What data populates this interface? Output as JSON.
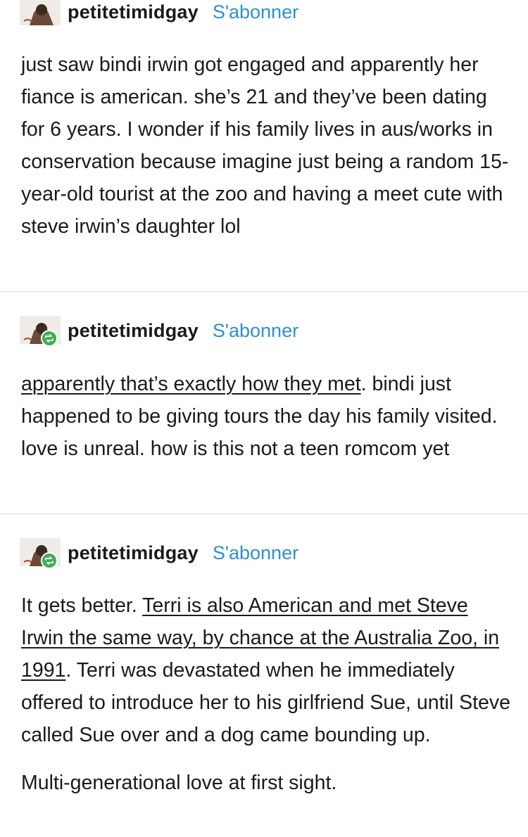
{
  "posts": [
    {
      "username": "petitetimidgay",
      "follow_label": "S'abonner",
      "is_reblog": false,
      "text": "just saw bindi irwin got engaged and apparently her fiance is american. she’s 21 and they’ve been dating for 6 years. I wonder if his family lives in aus/works in conservation because imagine just being a random 15-year-old tourist at the zoo and having a meet cute with steve irwin’s daughter lol"
    },
    {
      "username": "petitetimidgay",
      "follow_label": "S'abonner",
      "is_reblog": true,
      "link_text": "apparently that’s exactly how they met",
      "text_after_link": ". bindi just happened to be giving tours the day his family visited. love is unreal. how is this not a teen romcom yet"
    },
    {
      "username": "petitetimidgay",
      "follow_label": "S'abonner",
      "is_reblog": true,
      "text_before_link": "It gets better. ",
      "link_text": "Terri is also American and met Steve Irwin the same way, by chance at the Australia Zoo, in 1991",
      "text_after_link": ". Terri was devastated when he immediately offered to introduce her to his girlfriend Sue, until Steve called Sue over and a dog came bounding up.",
      "closing_paragraph": "Multi-generational love at first sight."
    }
  ],
  "colors": {
    "follow_link": "#2f8fd0",
    "reblog_badge": "#3bb054",
    "divider": "#d9d9d9",
    "text": "#1a1a1a"
  },
  "icons": {
    "avatar": "user-avatar",
    "reblog_badge": "reblog-icon"
  }
}
